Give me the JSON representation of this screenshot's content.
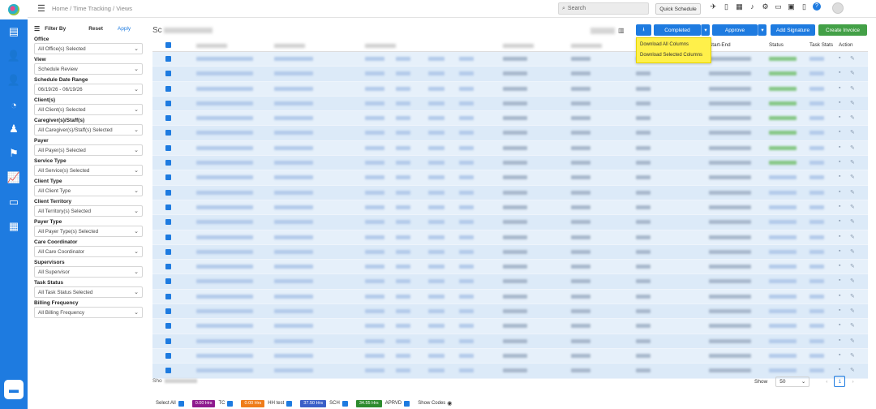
{
  "app": {
    "breadcrumb": "Home / Time Tracking / Views"
  },
  "topbar": {
    "search_placeholder": "Search",
    "quick_schedule": "Quick Schedule"
  },
  "filter": {
    "title": "Filter By",
    "reset": "Reset",
    "apply": "Apply",
    "groups": [
      {
        "label": "Office",
        "value": "All Office(s) Selected"
      },
      {
        "label": "View",
        "value": "Schedule Review"
      },
      {
        "label": "Schedule Date Range",
        "value": "06/19/26 - 06/19/26"
      },
      {
        "label": "Client(s)",
        "value": "All Client(s) Selected"
      },
      {
        "label": "Caregiver(s)/Staff(s)",
        "value": "All Caregiver(s)/Staff(s) Selected"
      },
      {
        "label": "Payer",
        "value": "All Payer(s) Selected"
      },
      {
        "label": "Service Type",
        "value": "All Service(s) Selected"
      },
      {
        "label": "Client Type",
        "value": "All Client Type"
      },
      {
        "label": "Client Territory",
        "value": "All Territory(s) Selected"
      },
      {
        "label": "Payer Type",
        "value": "All Payer Type(s) Selected"
      },
      {
        "label": "Care Coordinator",
        "value": "All Care Coordinator"
      },
      {
        "label": "Supervisors",
        "value": "All Supervisor"
      },
      {
        "label": "Task Status",
        "value": "All Task Status Selected"
      },
      {
        "label": "Billing Frequency",
        "value": "All Billing Frequency"
      }
    ]
  },
  "content": {
    "title_prefix": "Sc",
    "buttons": {
      "completed": "Completed",
      "approve": "Approve",
      "add_signature": "Add Signature",
      "create_invoice": "Create Invoice"
    },
    "download_menu": [
      "Download All Columns",
      "Download Selected Columns"
    ],
    "columns": {
      "start_end": "Start-End",
      "status": "Status",
      "task_stats": "Task Stats",
      "action": "Action"
    },
    "row_count": 22
  },
  "footer": {
    "showing_prefix": "Sho",
    "show_label": "Show",
    "page_size": "50",
    "current_page": "1",
    "select_all": "Select All",
    "legend": [
      {
        "hours": "0.00 Hrs",
        "label": "TC",
        "color": "#8e1a8e"
      },
      {
        "hours": "0.00 Hrs",
        "label": "HH test",
        "color": "#ef7c1a"
      },
      {
        "hours": "37.50 Hrs",
        "label": "SCH",
        "color": "#3a5fc8"
      },
      {
        "hours": "34.55 Hrs",
        "label": "APRVD",
        "color": "#2e8b2e"
      }
    ],
    "show_codes": "Show Codes"
  }
}
